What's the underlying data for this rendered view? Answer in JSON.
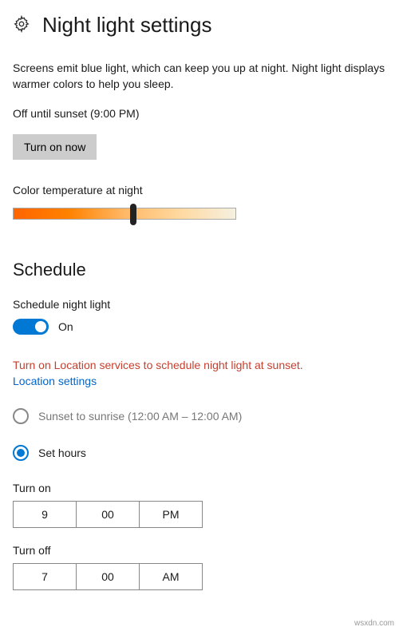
{
  "header": {
    "title": "Night light settings"
  },
  "description": "Screens emit blue light, which can keep you up at night. Night light displays warmer colors to help you sleep.",
  "status": "Off until sunset (9:00 PM)",
  "turn_on_button": "Turn on now",
  "color_temp": {
    "label": "Color temperature at night"
  },
  "schedule": {
    "heading": "Schedule",
    "toggle_label": "Schedule night light",
    "toggle_state": "On",
    "warning": "Turn on Location services to schedule night light at sunset.",
    "link": "Location settings",
    "options": {
      "sunset": "Sunset to sunrise (12:00 AM – 12:00 AM)",
      "set_hours": "Set hours"
    },
    "turn_on": {
      "label": "Turn on",
      "hour": "9",
      "minute": "00",
      "ampm": "PM"
    },
    "turn_off": {
      "label": "Turn off",
      "hour": "7",
      "minute": "00",
      "ampm": "AM"
    }
  },
  "watermark": "wsxdn.com"
}
